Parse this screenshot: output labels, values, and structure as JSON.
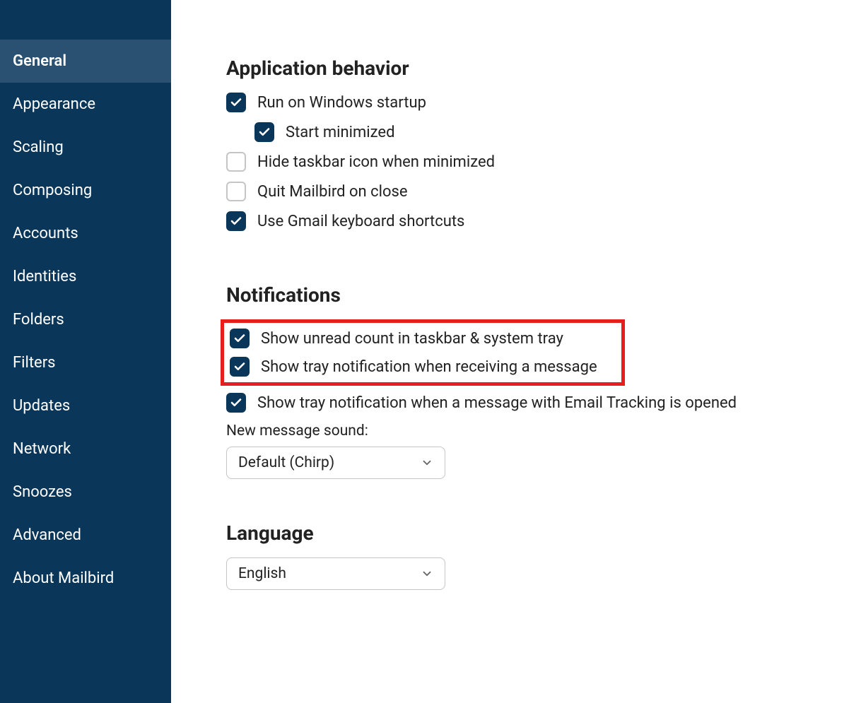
{
  "sidebar": {
    "items": [
      {
        "label": "General",
        "active": true
      },
      {
        "label": "Appearance",
        "active": false
      },
      {
        "label": "Scaling",
        "active": false
      },
      {
        "label": "Composing",
        "active": false
      },
      {
        "label": "Accounts",
        "active": false
      },
      {
        "label": "Identities",
        "active": false
      },
      {
        "label": "Folders",
        "active": false
      },
      {
        "label": "Filters",
        "active": false
      },
      {
        "label": "Updates",
        "active": false
      },
      {
        "label": "Network",
        "active": false
      },
      {
        "label": "Snoozes",
        "active": false
      },
      {
        "label": "Advanced",
        "active": false
      },
      {
        "label": "About Mailbird",
        "active": false
      }
    ]
  },
  "main": {
    "sections": {
      "application_behavior": {
        "title": "Application behavior",
        "options": {
          "run_on_startup": {
            "label": "Run on Windows startup",
            "checked": true
          },
          "start_minimized": {
            "label": "Start minimized",
            "checked": true
          },
          "hide_taskbar": {
            "label": "Hide taskbar icon when minimized",
            "checked": false
          },
          "quit_on_close": {
            "label": "Quit Mailbird on close",
            "checked": false
          },
          "gmail_shortcuts": {
            "label": "Use Gmail keyboard shortcuts",
            "checked": true
          }
        }
      },
      "notifications": {
        "title": "Notifications",
        "options": {
          "show_unread_count": {
            "label": "Show unread count in taskbar & system tray",
            "checked": true
          },
          "show_tray_message": {
            "label": "Show tray notification when receiving a message",
            "checked": true
          },
          "show_tray_tracking": {
            "label": "Show tray notification when a message with Email Tracking is opened",
            "checked": true
          }
        },
        "sound_label": "New message sound:",
        "sound_value": "Default (Chirp)"
      },
      "language": {
        "title": "Language",
        "value": "English"
      }
    }
  }
}
